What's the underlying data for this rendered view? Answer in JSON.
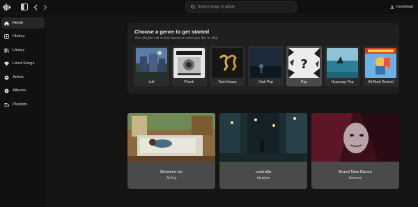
{
  "topbar": {
    "search_placeholder": "Search songs or artists",
    "download_label": "Download"
  },
  "sidebar": {
    "items": [
      {
        "label": "Home",
        "icon": "home-icon",
        "active": true
      },
      {
        "label": "History",
        "icon": "history-icon"
      },
      {
        "label": "Library",
        "icon": "library-icon"
      },
      {
        "label": "Liked Songs",
        "icon": "heart-icon"
      },
      {
        "label": "Artists",
        "icon": "artists-icon"
      },
      {
        "label": "Albums",
        "icon": "album-icon"
      },
      {
        "label": "Playlists",
        "icon": "playlist-icon"
      }
    ]
  },
  "genres": {
    "title": "Choose a genre to get started",
    "subtitle": "Your playlist will evolve based on what you like or skip.",
    "items": [
      {
        "label": "Lofi"
      },
      {
        "label": "Phonk"
      },
      {
        "label": "Tech House"
      },
      {
        "label": "Dark Pop"
      },
      {
        "label": "Pop",
        "selected": true
      },
      {
        "label": "Hyperpop Pop"
      },
      {
        "label": "Alt Rock Revival"
      }
    ]
  },
  "albums": [
    {
      "title": "Between Us",
      "artist": "Ali Kaj"
    },
    {
      "title": "controlla",
      "artist": "Idealism"
    },
    {
      "title": "Brand New Dance",
      "artist": "Eminem"
    }
  ],
  "colors": {
    "background": "#141414",
    "sidebar": "#111111",
    "panel": "#1f1f1f",
    "active_nav": "#262626",
    "selected_genre": "#4a4a4a"
  }
}
